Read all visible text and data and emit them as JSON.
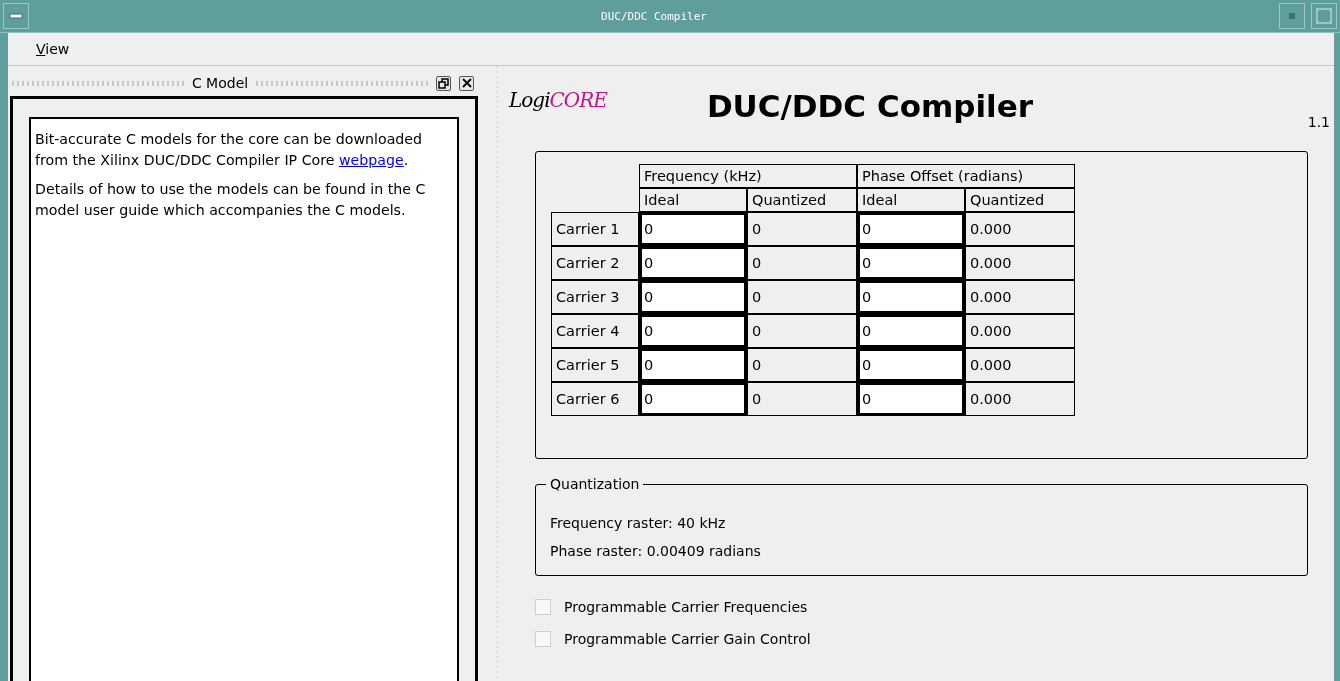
{
  "window": {
    "title": "DUC/DDC Compiler"
  },
  "menu": [
    {
      "label": "View"
    }
  ],
  "c_model_panel": {
    "title": "C Model",
    "paragraphs": [
      "Bit-accurate C models for the core can be downloaded from the Xilinx DUC/DDC Compiler IP Core ",
      "Details of how to use the models can be found in the C model user guide which accompanies the C models."
    ],
    "link": "webpage",
    "link_suffix": "."
  },
  "header": {
    "logo_left": "Logi",
    "logo_right": "CORE",
    "title": "DUC/DDC Compiler",
    "version": "1.1"
  },
  "carrier_table": {
    "groups": [
      "Frequency (kHz)",
      "Phase Offset (radians)"
    ],
    "columns": [
      "Ideal",
      "Quantized",
      "Ideal",
      "Quantized"
    ],
    "rows": [
      {
        "label": "Carrier 1",
        "freq_ideal": "0",
        "freq_quantized": "0",
        "phase_ideal": "0",
        "phase_quantized": "0.000"
      },
      {
        "label": "Carrier 2",
        "freq_ideal": "0",
        "freq_quantized": "0",
        "phase_ideal": "0",
        "phase_quantized": "0.000"
      },
      {
        "label": "Carrier 3",
        "freq_ideal": "0",
        "freq_quantized": "0",
        "phase_ideal": "0",
        "phase_quantized": "0.000"
      },
      {
        "label": "Carrier 4",
        "freq_ideal": "0",
        "freq_quantized": "0",
        "phase_ideal": "0",
        "phase_quantized": "0.000"
      },
      {
        "label": "Carrier 5",
        "freq_ideal": "0",
        "freq_quantized": "0",
        "phase_ideal": "0",
        "phase_quantized": "0.000"
      },
      {
        "label": "Carrier 6",
        "freq_ideal": "0",
        "freq_quantized": "0",
        "phase_ideal": "0",
        "phase_quantized": "0.000"
      }
    ]
  },
  "quantization": {
    "title": "Quantization",
    "lines": [
      "Frequency raster: 40 kHz",
      "Phase raster: 0.00409 radians"
    ]
  },
  "options": [
    {
      "label": "Programmable Carrier Frequencies",
      "checked": false
    },
    {
      "label": "Programmable Carrier Gain Control",
      "checked": false
    }
  ]
}
